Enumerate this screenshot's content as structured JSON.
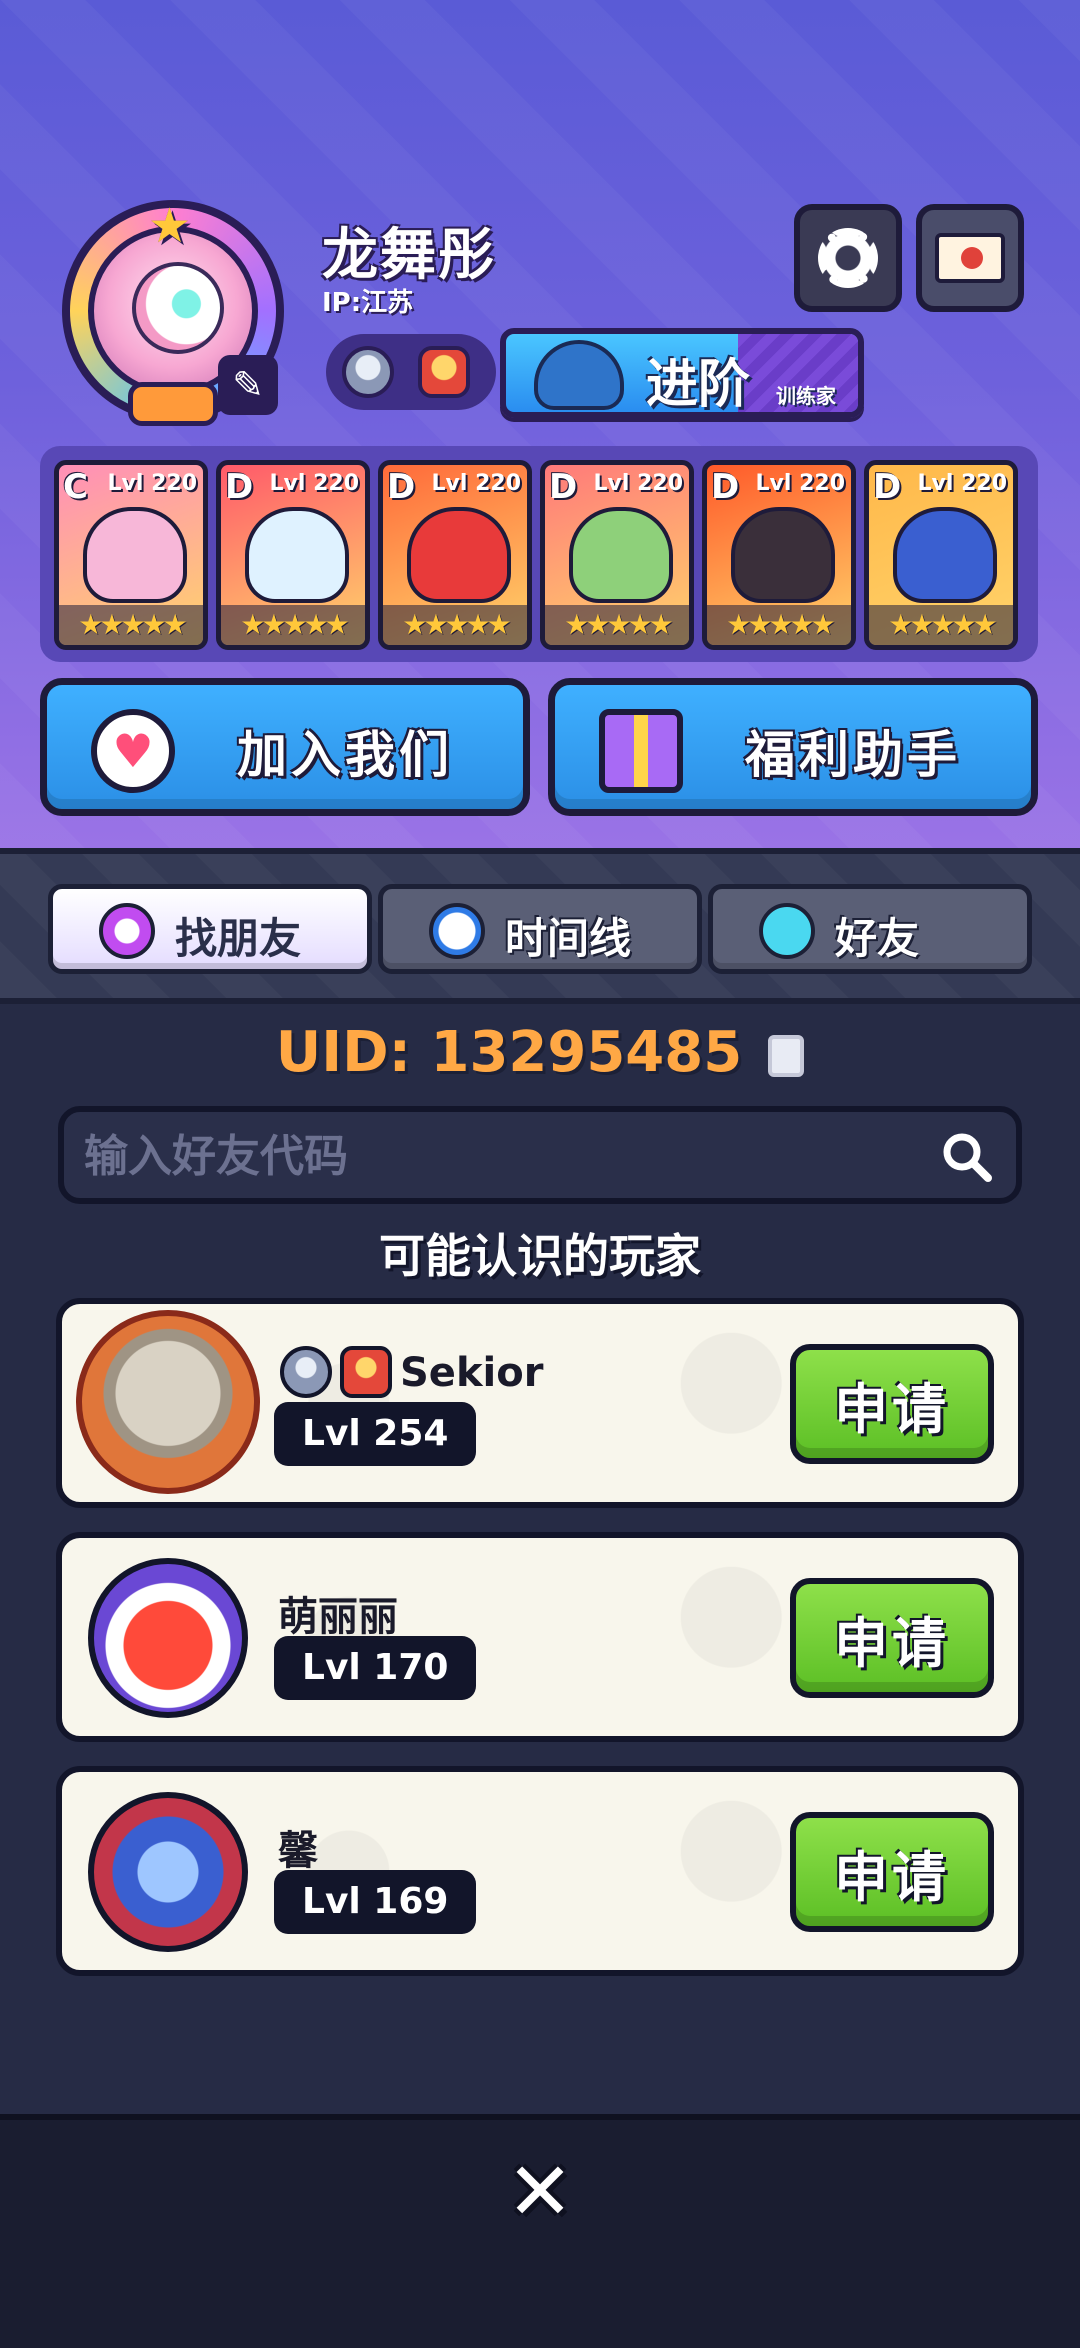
{
  "profile": {
    "name": "龙舞彤",
    "ip": "IP:江苏",
    "advance_label": "进阶",
    "advance_sub": "训练家"
  },
  "team": [
    {
      "tier": "C",
      "level": "Lvl 220",
      "color": "#ff8fb8",
      "monster": "#f7b7d8",
      "stars": "★★★★★"
    },
    {
      "tier": "D",
      "level": "Lvl 220",
      "color": "#ff5a6a",
      "monster": "#dff2ff",
      "stars": "★★★★★"
    },
    {
      "tier": "D",
      "level": "Lvl 220",
      "color": "#ff6a3a",
      "monster": "#e83a3a",
      "stars": "★★★★★"
    },
    {
      "tier": "D",
      "level": "Lvl 220",
      "color": "#ff7a7a",
      "monster": "#8ed07a",
      "stars": "★★★★★"
    },
    {
      "tier": "D",
      "level": "Lvl 220",
      "color": "#ff5a2a",
      "monster": "#3a2f3a",
      "stars": "★★★★★"
    },
    {
      "tier": "D",
      "level": "Lvl 220",
      "color": "#ffb84a",
      "monster": "#3a5fd0",
      "stars": "★★★★★"
    }
  ],
  "actions": {
    "join_label": "加入我们",
    "welfare_label": "福利助手"
  },
  "tabs": {
    "find": "找朋友",
    "timeline": "时间线",
    "friends": "好友"
  },
  "uid": {
    "text": "UID: 13295485"
  },
  "search": {
    "placeholder": "输入好友代码"
  },
  "section_title": "可能认识的玩家",
  "players": [
    {
      "name": "Sekior",
      "level": "Lvl 254",
      "button": "申请"
    },
    {
      "name": "萌丽丽",
      "level": "Lvl 170",
      "button": "申请"
    },
    {
      "name": "馨　",
      "level": "Lvl 169",
      "button": "申请"
    }
  ],
  "close_label": "✕"
}
